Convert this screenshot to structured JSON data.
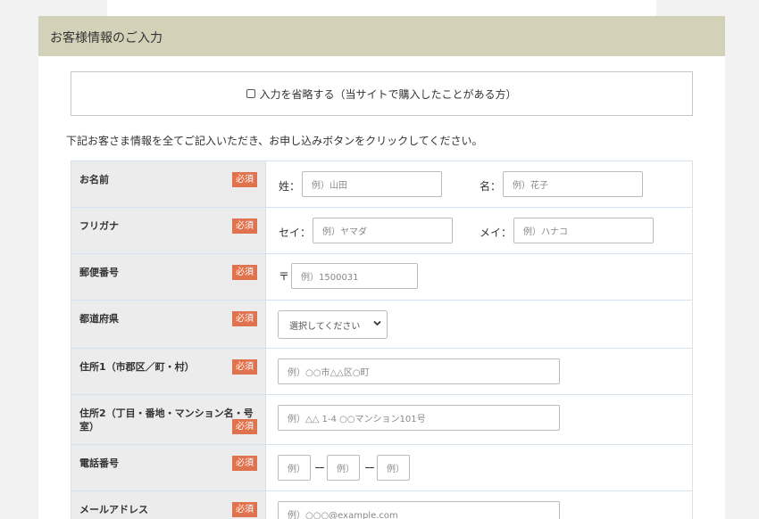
{
  "panel": {
    "title": "お客様情報のご入力"
  },
  "skip": {
    "label": "入力を省略する（当サイトで購入したことがある方）"
  },
  "instruction": "下記お客さま情報を全てご記入いただき、お申し込みボタンをクリックしてください。",
  "required_label": "必須",
  "rows": {
    "name": {
      "label": "お名前",
      "sei_prefix": "姓：",
      "sei_placeholder": "例）山田",
      "mei_prefix": "名：",
      "mei_placeholder": "例）花子"
    },
    "kana": {
      "label": "フリガナ",
      "sei_prefix": "セイ：",
      "sei_placeholder": "例）ヤマダ",
      "mei_prefix": "メイ：",
      "mei_placeholder": "例）ハナコ"
    },
    "zip": {
      "label": "郵便番号",
      "prefix": "〒",
      "placeholder": "例）1500031"
    },
    "pref": {
      "label": "都道府県",
      "selected": "選択してください"
    },
    "addr1": {
      "label": "住所1（市郡区／町・村）",
      "placeholder": "例）○○市△△区○町"
    },
    "addr2": {
      "label": "住所2（丁目・番地・マンション名・号室）",
      "placeholder": "例）△△ 1-4 ○○マンション101号"
    },
    "tel": {
      "label": "電話番号",
      "placeholder1": "例）",
      "placeholder2": "例）",
      "placeholder3": "例）"
    },
    "email": {
      "label": "メールアドレス",
      "placeholder": "例）○○○@example.com"
    }
  },
  "colors": {
    "header_bg": "#d3d2b9",
    "required_badge": "#e0734f",
    "label_bg": "#ececec"
  }
}
